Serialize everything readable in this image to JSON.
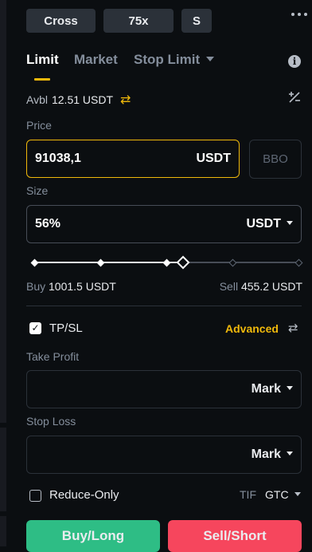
{
  "top_bar": {
    "margin_mode": "Cross",
    "leverage": "75x",
    "asset_mode": "S"
  },
  "order_tabs": {
    "limit": "Limit",
    "market": "Market",
    "stop_limit": "Stop Limit"
  },
  "available": {
    "label": "Avbl",
    "value": "12.51 USDT"
  },
  "price": {
    "label": "Price",
    "value": "91038,1",
    "unit": "USDT",
    "bbo": "BBO"
  },
  "size": {
    "label": "Size",
    "value": "56%",
    "unit": "USDT",
    "percent": 56
  },
  "limits": {
    "buy_label": "Buy",
    "buy_value": "1001.5 USDT",
    "sell_label": "Sell",
    "sell_value": "455.2 USDT"
  },
  "tpsl": {
    "label": "TP/SL",
    "checked": true,
    "advanced": "Advanced"
  },
  "take_profit": {
    "label": "Take Profit",
    "trigger": "Mark"
  },
  "stop_loss": {
    "label": "Stop Loss",
    "trigger": "Mark"
  },
  "reduce_only": {
    "label": "Reduce-Only",
    "checked": false
  },
  "tif": {
    "label": "TIF",
    "value": "GTC"
  },
  "actions": {
    "buy": "Buy/Long",
    "sell": "Sell/Short"
  },
  "colors": {
    "accent": "#f0b90b",
    "buy": "#2ebd85",
    "sell": "#f6465d",
    "background": "#0b0e11"
  },
  "icons": [
    "more-dots-icon",
    "info-icon",
    "swap-icon",
    "calculator-icon",
    "checkbox-icon",
    "transfer-icon"
  ]
}
